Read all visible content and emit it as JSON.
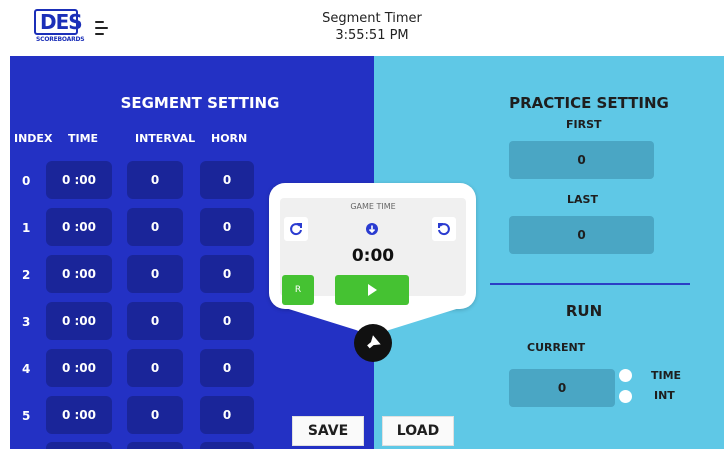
{
  "header": {
    "logo_text": "DES",
    "logo_subtext": "SCOREBOARDS",
    "title": "Segment Timer",
    "clock": "3:55:51 PM"
  },
  "segment": {
    "title": "SEGMENT SETTING",
    "columns": {
      "index": "INDEX",
      "time": "TIME",
      "interval": "INTERVAL",
      "horn": "HORN"
    },
    "rows": [
      {
        "index": "0",
        "time": "0 :00",
        "interval": "0",
        "horn": "0"
      },
      {
        "index": "1",
        "time": "0 :00",
        "interval": "0",
        "horn": "0"
      },
      {
        "index": "2",
        "time": "0 :00",
        "interval": "0",
        "horn": "0"
      },
      {
        "index": "3",
        "time": "0 :00",
        "interval": "0",
        "horn": "0"
      },
      {
        "index": "4",
        "time": "0 :00",
        "interval": "0",
        "horn": "0"
      },
      {
        "index": "5",
        "time": "0 :00",
        "interval": "0",
        "horn": "0"
      }
    ]
  },
  "practice": {
    "title": "PRACTICE SETTING",
    "first_label": "FIRST",
    "first_value": "0",
    "last_label": "LAST",
    "last_value": "0"
  },
  "run": {
    "title": "RUN",
    "current_label": "CURRENT",
    "current_value": "0",
    "options": [
      "TIME",
      "INT"
    ]
  },
  "game": {
    "label": "GAME TIME",
    "time": "0:00",
    "reset_label": "R"
  },
  "actions": {
    "save_label": "SAVE",
    "load_label": "LOAD"
  },
  "colors": {
    "left_panel": "#2331c4",
    "right_panel": "#5fc8e6",
    "play_green": "#45c232",
    "cell_dark": "#1a2599"
  }
}
